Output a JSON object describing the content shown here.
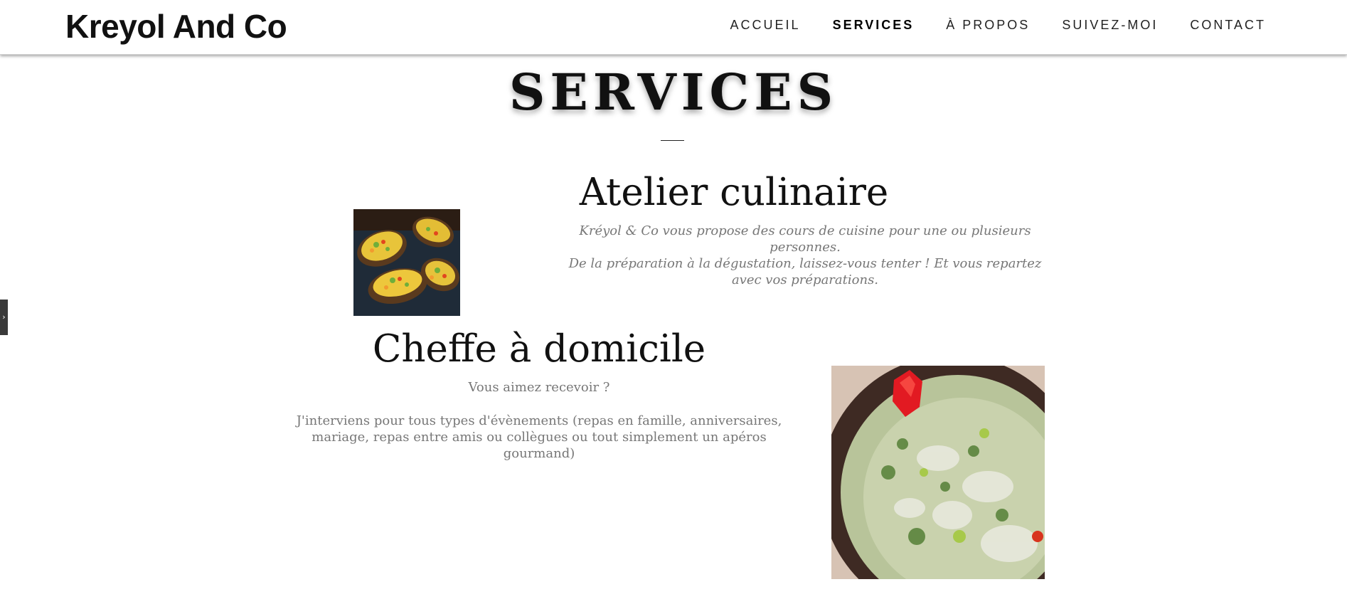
{
  "header": {
    "brand": "Kreyol And Co",
    "nav": [
      {
        "label": "ACCUEIL"
      },
      {
        "label": "SERVICES"
      },
      {
        "label": "À PROPOS"
      },
      {
        "label": "SUIVEZ-MOI"
      },
      {
        "label": "CONTACT"
      }
    ],
    "active_nav": "SERVICES"
  },
  "side_toggle": {
    "icon": "chevron-right-icon",
    "glyph": "›"
  },
  "page": {
    "title": "SERVICES"
  },
  "services": [
    {
      "heading": "Atelier culinaire",
      "paragraphs": [
        "Kréyol & Co vous propose des cours de cuisine pour une ou plusieurs personnes.",
        "De la préparation à la dégustation, laissez-vous tenter ! Et vous repartez avec vos préparations."
      ]
    },
    {
      "heading": "Cheffe à domicile",
      "paragraphs": [
        "Vous aimez recevoir ?",
        "J'interviens pour tous types d'évènements (repas en famille, anniversaires, mariage, repas entre amis ou collègues ou tout simplement un apéros gourmand)"
      ]
    }
  ],
  "colors": {
    "text_dark": "#111111",
    "text_muted": "#777777",
    "header_bg": "#ffffff",
    "toggle_bg": "#3a3a3a"
  }
}
